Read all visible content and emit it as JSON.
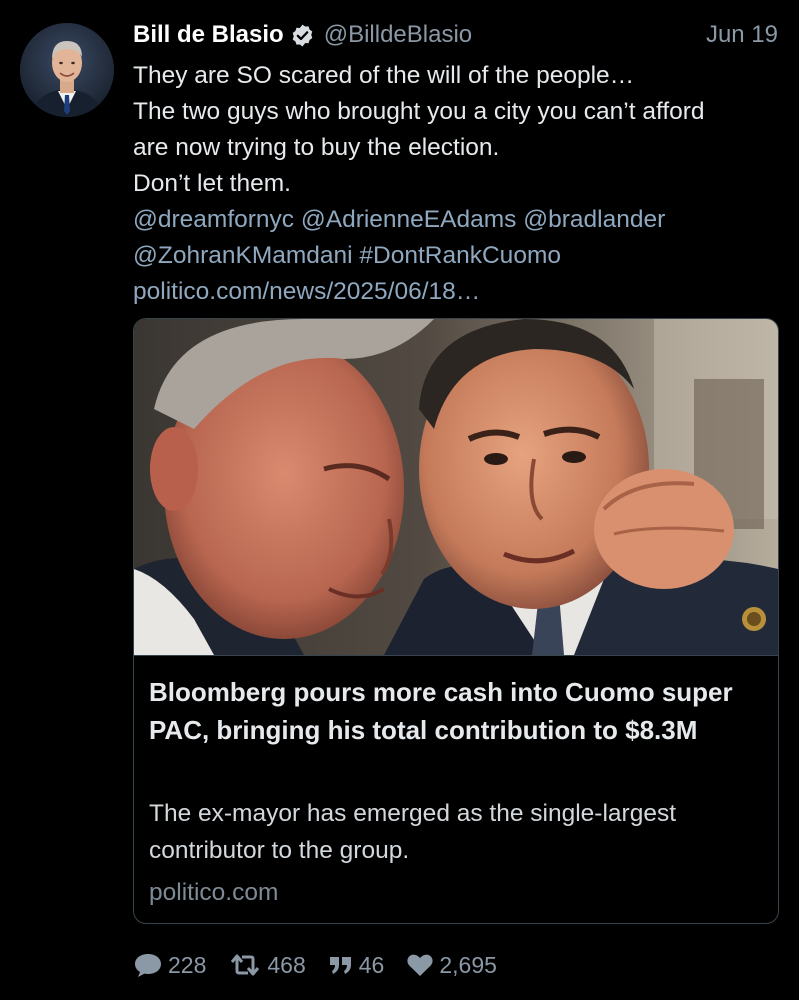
{
  "tweet": {
    "author": {
      "display_name": "Bill de Blasio",
      "handle": "@BilldeBlasio",
      "verified": true
    },
    "date": "Jun 19",
    "text_lines": [
      "They are SO scared of the will of the people…",
      "The two guys who brought you a city you can’t afford",
      "are now trying to buy the election.",
      "Don’t let them."
    ],
    "mentions": [
      "@dreamfornyc",
      "@AdrienneEAdams",
      "@bradlander",
      "@ZohranKMamdani"
    ],
    "hashtag": "#DontRankCuomo",
    "link": "politico.com/news/2025/06/18…",
    "card": {
      "title": "Bloomberg pours more cash into Cuomo super PAC, bringing his total contribution to $8.3M",
      "description": "The ex-mayor has emerged as the single-largest contributor to the group.",
      "domain": "politico.com"
    },
    "actions": {
      "replies": "228",
      "retweets": "468",
      "quotes": "46",
      "likes": "2,695"
    }
  },
  "colors": {
    "background": "#000000",
    "text": "#e6eaed",
    "secondary_text": "#8b98a5",
    "link": "#8fa8bf",
    "border": "#38444d"
  },
  "icons": {
    "verified": "verified-badge-icon",
    "reply": "speech-bubble-icon",
    "retweet": "retweet-arrows-icon",
    "quote": "quote-marks-icon",
    "like": "heart-icon"
  }
}
